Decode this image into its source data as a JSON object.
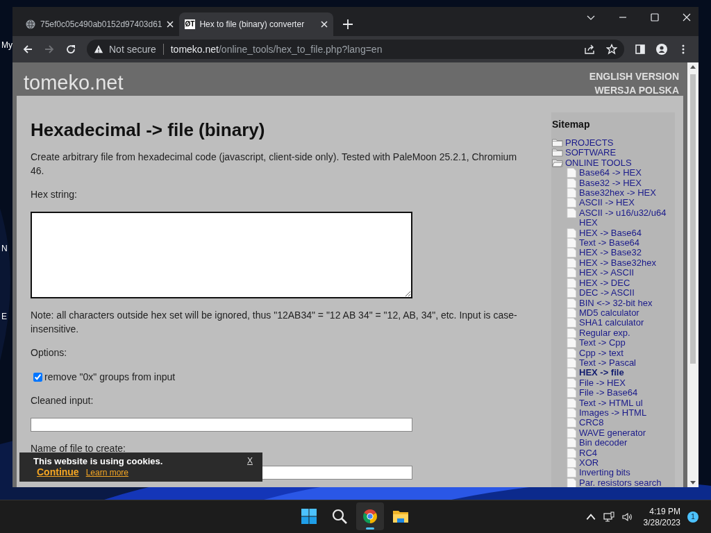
{
  "desktop": {
    "icon_labels": [
      "My",
      "N",
      "E"
    ]
  },
  "browser": {
    "tabs": [
      {
        "kind": "globe",
        "title": "75ef0c05c490ab0152d97403d61",
        "selected": false
      },
      {
        "kind": "favicon",
        "favicon_text": "ØT",
        "title": "Hex to file (binary) converter",
        "selected": true
      }
    ],
    "forward_disabled": true,
    "security": "Not secure",
    "url_host": "tomeko.net",
    "url_path": "/online_tools/hex_to_file.php?lang=en"
  },
  "page": {
    "site_name": "tomeko.net",
    "languages": [
      "ENGLISH VERSION",
      "WERSJA POLSKA"
    ],
    "heading": "Hexadecimal -> file (binary)",
    "intro": "Create arbitrary file from hexadecimal code (javascript, client-side only). Tested with PaleMoon 25.2.1, Chromium 46.",
    "hex_label": "Hex string:",
    "note": "Note: all characters outside hex set will be ignored, thus \"12AB34\" = \"12 AB 34\" = \"12, AB, 34\", etc. Input is case-insensitive.",
    "options_label": "Options:",
    "options": [
      {
        "label": "remove \"0x\" groups from input",
        "checked": true
      }
    ],
    "cleaned_label": "Cleaned input:",
    "filename_label": "Name of file to create:"
  },
  "sitemap": {
    "title": "Sitemap",
    "items": [
      {
        "label": "PROJECTS",
        "expanded": false
      },
      {
        "label": "SOFTWARE",
        "expanded": false
      },
      {
        "label": "ONLINE TOOLS",
        "expanded": true,
        "children": [
          {
            "label": "Base64 -> HEX",
            "selected": false
          },
          {
            "label": "Base32 -> HEX",
            "selected": false
          },
          {
            "label": "Base32hex -> HEX",
            "selected": false
          },
          {
            "label": "ASCII -> HEX",
            "selected": false
          },
          {
            "label": "ASCII -> u16/u32/u64 HEX",
            "selected": false
          },
          {
            "label": "HEX -> Base64",
            "selected": false
          },
          {
            "label": "Text -> Base64",
            "selected": false
          },
          {
            "label": "HEX -> Base32",
            "selected": false
          },
          {
            "label": "HEX -> Base32hex",
            "selected": false
          },
          {
            "label": "HEX -> ASCII",
            "selected": false
          },
          {
            "label": "HEX -> DEC",
            "selected": false
          },
          {
            "label": "DEC -> ASCII",
            "selected": false
          },
          {
            "label": "BIN <-> 32-bit hex",
            "selected": false
          },
          {
            "label": "MD5 calculator",
            "selected": false
          },
          {
            "label": "SHA1 calculator",
            "selected": false
          },
          {
            "label": "Regular exp.",
            "selected": false
          },
          {
            "label": "Text -> Cpp",
            "selected": false
          },
          {
            "label": "Cpp -> text",
            "selected": false
          },
          {
            "label": "Text -> Pascal",
            "selected": false
          },
          {
            "label": "HEX -> file",
            "selected": true
          },
          {
            "label": "File -> HEX",
            "selected": false
          },
          {
            "label": "File -> Base64",
            "selected": false
          },
          {
            "label": "Text -> HTML ul",
            "selected": false
          },
          {
            "label": "Images -> HTML",
            "selected": false
          },
          {
            "label": "CRC8",
            "selected": false
          },
          {
            "label": "WAVE generator",
            "selected": false
          },
          {
            "label": "Bin decoder",
            "selected": false
          },
          {
            "label": "RC4",
            "selected": false
          },
          {
            "label": "XOR",
            "selected": false
          },
          {
            "label": "Inverting bits",
            "selected": false
          },
          {
            "label": "Par. resistors search",
            "selected": false
          }
        ]
      }
    ]
  },
  "cookie_notice": {
    "message": "This website is using cookies.",
    "continue": "Continue",
    "learn_more": "Learn more",
    "close": "X"
  },
  "taskbar": {
    "apps": [
      {
        "kind": "start",
        "selected": false
      },
      {
        "kind": "search",
        "selected": false
      },
      {
        "kind": "chrome",
        "selected": true
      },
      {
        "kind": "files",
        "selected": false
      }
    ],
    "time": "4:19 PM",
    "date": "3/28/2023",
    "notification_count": "1"
  }
}
